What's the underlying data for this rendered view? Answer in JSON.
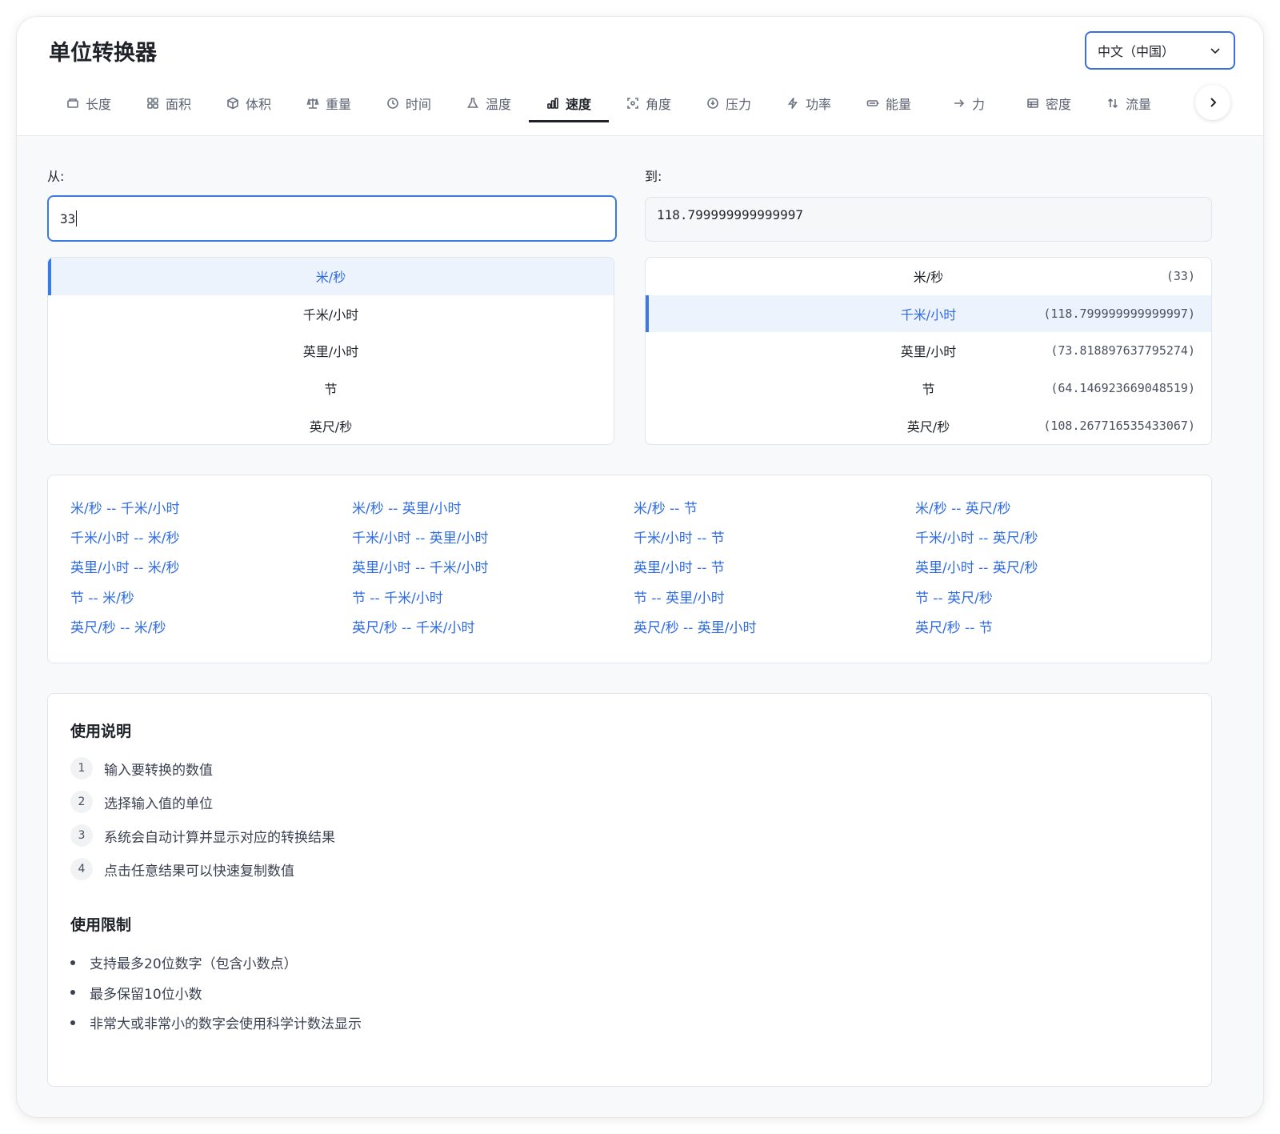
{
  "app": {
    "title": "单位转换器"
  },
  "language": {
    "selected": "中文（中国）"
  },
  "tabs": [
    {
      "label": "长度",
      "icon": "ruler-icon"
    },
    {
      "label": "面积",
      "icon": "grid-icon"
    },
    {
      "label": "体积",
      "icon": "cube-icon"
    },
    {
      "label": "重量",
      "icon": "scale-icon"
    },
    {
      "label": "时间",
      "icon": "clock-icon"
    },
    {
      "label": "温度",
      "icon": "flask-icon"
    },
    {
      "label": "速度",
      "icon": "bar-chart-icon",
      "active": true
    },
    {
      "label": "角度",
      "icon": "focus-icon"
    },
    {
      "label": "压力",
      "icon": "gauge-icon"
    },
    {
      "label": "功率",
      "icon": "lightning-icon"
    },
    {
      "label": "能量",
      "icon": "battery-icon"
    },
    {
      "label": "力",
      "icon": "arrow-right-icon"
    },
    {
      "label": "密度",
      "icon": "table-icon"
    },
    {
      "label": "流量",
      "icon": "swap-icon"
    },
    {
      "label": "",
      "icon": "refresh-icon"
    }
  ],
  "from": {
    "label": "从:",
    "value": "33",
    "units": [
      "米/秒",
      "千米/小时",
      "英里/小时",
      "节",
      "英尺/秒"
    ],
    "selected_index": 0
  },
  "to": {
    "label": "到:",
    "value": "118.799999999999997",
    "units": [
      {
        "name": "米/秒",
        "value": "(33)"
      },
      {
        "name": "千米/小时",
        "value": "(118.799999999999997)"
      },
      {
        "name": "英里/小时",
        "value": "(73.818897637795274)"
      },
      {
        "name": "节",
        "value": "(64.146923669048519)"
      },
      {
        "name": "英尺/秒",
        "value": "(108.267716535433067)"
      }
    ],
    "selected_index": 1
  },
  "conversion_links": [
    "米/秒 -- 千米/小时",
    "米/秒 -- 英里/小时",
    "米/秒 -- 节",
    "米/秒 -- 英尺/秒",
    "千米/小时 -- 米/秒",
    "千米/小时 -- 英里/小时",
    "千米/小时 -- 节",
    "千米/小时 -- 英尺/秒",
    "英里/小时 -- 米/秒",
    "英里/小时 -- 千米/小时",
    "英里/小时 -- 节",
    "英里/小时 -- 英尺/秒",
    "节 -- 米/秒",
    "节 -- 千米/小时",
    "节 -- 英里/小时",
    "节 -- 英尺/秒",
    "英尺/秒 -- 米/秒",
    "英尺/秒 -- 千米/小时",
    "英尺/秒 -- 英里/小时",
    "英尺/秒 -- 节"
  ],
  "instructions": {
    "title": "使用说明",
    "steps": [
      {
        "num": "1",
        "text": "输入要转换的数值"
      },
      {
        "num": "2",
        "text": "选择输入值的单位"
      },
      {
        "num": "3",
        "text": "系统会自动计算并显示对应的转换结果"
      },
      {
        "num": "4",
        "text": "点击任意结果可以快速复制数值"
      }
    ]
  },
  "limits": {
    "title": "使用限制",
    "items": [
      "支持最多20位数字（包含小数点）",
      "最多保留10位小数",
      "非常大或非常小的数字会使用科学计数法显示"
    ]
  },
  "colors": {
    "accent": "#3a7be3",
    "link": "#2e6be0",
    "selected_bg": "#edf3fd"
  }
}
